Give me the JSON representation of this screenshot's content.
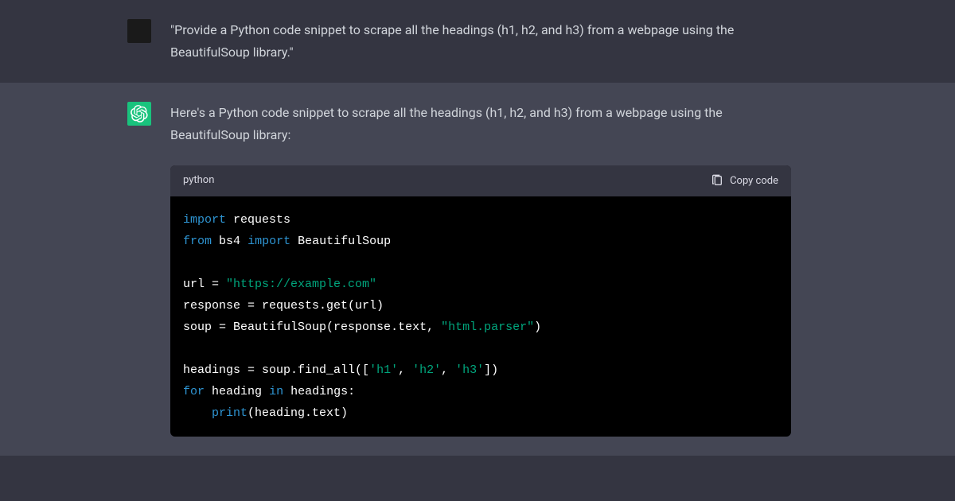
{
  "user_message": "\"Provide a Python code snippet to scrape all the headings (h1, h2, and h3) from a webpage using the BeautifulSoup library.\"",
  "assistant_message_intro": "Here's a Python code snippet to scrape all the headings (h1, h2, and h3) from a webpage using the BeautifulSoup library:",
  "code_block": {
    "language": "python",
    "copy_label": "Copy code",
    "tokens": {
      "kw_import": "import",
      "kw_from": "from",
      "kw_for": "for",
      "kw_in": "in",
      "mod_requests": "requests",
      "mod_bs4": "bs4",
      "cls_bs": "BeautifulSoup",
      "var_url": "url",
      "op_assign_sp": " = ",
      "str_url": "\"https://example.com\"",
      "var_response": "response",
      "call_reqget": "requests.get(url)",
      "var_soup": "soup",
      "call_bs_open": "BeautifulSoup(response.text, ",
      "str_parser": "\"html.parser\"",
      "paren_close": ")",
      "var_headings": "headings",
      "call_findall_open": "soup.find_all([",
      "str_h1": "'h1'",
      "str_h2": "'h2'",
      "str_h3": "'h3'",
      "comma_sp": ", ",
      "brack_close": "])",
      "var_heading": "heading",
      "loop_tail": " headings:",
      "indent_print": "    print",
      "print_arg": "(heading.text)",
      "space": " "
    }
  }
}
